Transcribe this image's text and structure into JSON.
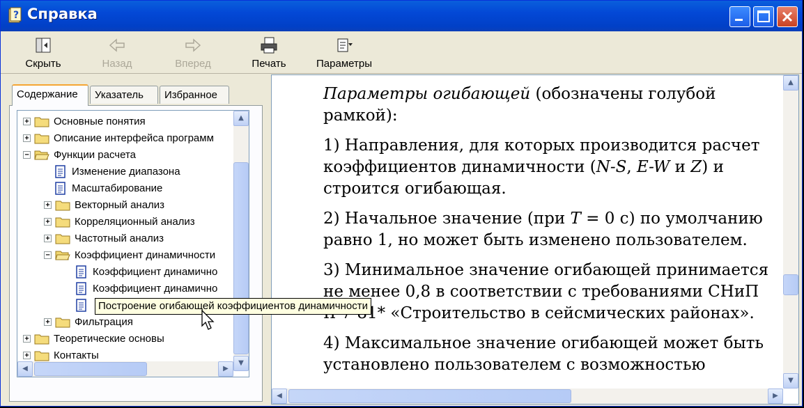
{
  "window": {
    "title": "Справка"
  },
  "toolbar": {
    "hide_label": "Скрыть",
    "back_label": "Назад",
    "forward_label": "Вперед",
    "print_label": "Печать",
    "options_label": "Параметры"
  },
  "tabs": [
    {
      "label": "Содержание",
      "active": true
    },
    {
      "label": "Указатель",
      "active": false
    },
    {
      "label": "Избранное",
      "active": false
    }
  ],
  "tree": [
    {
      "label": "Основные понятия",
      "level": 0,
      "type": "folder",
      "expanded": false
    },
    {
      "label": "Описание интерфейса программ",
      "level": 0,
      "type": "folder",
      "expanded": false
    },
    {
      "label": "Функции расчета",
      "level": 0,
      "type": "folder",
      "expanded": true
    },
    {
      "label": "Изменение диапазона",
      "level": 1,
      "type": "page"
    },
    {
      "label": "Масштабирование",
      "level": 1,
      "type": "page"
    },
    {
      "label": "Векторный анализ",
      "level": 1,
      "type": "folder",
      "expanded": false
    },
    {
      "label": "Корреляционный анализ",
      "level": 1,
      "type": "folder",
      "expanded": false
    },
    {
      "label": "Частотный анализ",
      "level": 1,
      "type": "folder",
      "expanded": false
    },
    {
      "label": "Коэффициент динамичности",
      "level": 1,
      "type": "folder",
      "expanded": true
    },
    {
      "label": "Коэффициент динамично",
      "level": 2,
      "type": "page"
    },
    {
      "label": "Коэффициент динамично",
      "level": 2,
      "type": "page"
    },
    {
      "label": "",
      "level": 2,
      "type": "page"
    },
    {
      "label": "Фильтрация",
      "level": 1,
      "type": "folder",
      "expanded": false
    },
    {
      "label": "Теоретические основы",
      "level": 0,
      "type": "folder",
      "expanded": false
    },
    {
      "label": "Контакты",
      "level": 0,
      "type": "folder",
      "expanded": false
    }
  ],
  "tooltip": "Построение огибающей коэффициентов динамичности",
  "content": {
    "p1_italic": "Параметры огибающей",
    "p1_rest": " (обозначены голубой рамкой):",
    "p2a": "1) Направления, для которых производится расчет коэффициентов динамичности (",
    "p2_ns": "N-S",
    "p2b": ", ",
    "p2_ew": "E-W",
    "p2c": " и ",
    "p2_z": "Z",
    "p2d": ") и строится огибающая.",
    "p3a": "2) Начальное значение (при ",
    "p3_t": "T",
    "p3b": " = 0 с) по умолчанию равно 1, но может быть изменено пользователем.",
    "p4": "3) Минимальное значение огибающей принимается не менее 0,8 в соответствии с требованиями СНиП II-7-81* «Строительство в сейсмических районах».",
    "p5": "4) Максимальное значение огибающей может быть установлено пользователем с возможностью"
  },
  "colors": {
    "titlebar": "#0348d6",
    "face": "#ece9d8",
    "tooltip_bg": "#ffffe1"
  }
}
